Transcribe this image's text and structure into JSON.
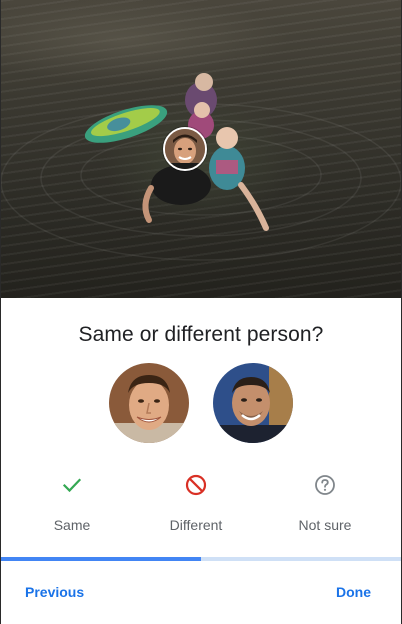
{
  "dialog": {
    "title": "Same or different person?"
  },
  "choices": [
    {
      "label": "Same",
      "icon": "check-icon",
      "color": "#34a853"
    },
    {
      "label": "Different",
      "icon": "block-icon",
      "color": "#d93025"
    },
    {
      "label": "Not sure",
      "icon": "help-circle-icon",
      "color": "#80868b"
    }
  ],
  "progress": {
    "fraction": 0.5,
    "fill_color": "#4285f4",
    "track_color": "#cfe0f6"
  },
  "footer": {
    "previous_label": "Previous",
    "done_label": "Done"
  },
  "colors": {
    "accent": "#1a73e8"
  }
}
